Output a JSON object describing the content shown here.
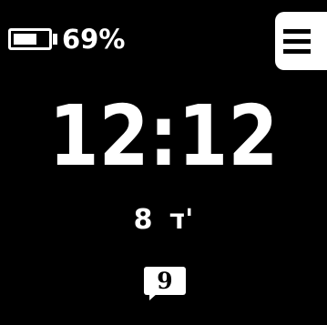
{
  "status": {
    "battery_percent_text": "69%",
    "battery_level": 0.69
  },
  "menu": {
    "icon": "hamburger-menu-icon"
  },
  "clock": {
    "time": "12:12"
  },
  "date": {
    "day": "8",
    "hebrew_marker": "ד'"
  },
  "notification": {
    "count": "9",
    "icon": "message-bubble-icon"
  },
  "colors": {
    "background": "#000000",
    "foreground": "#ffffff"
  }
}
